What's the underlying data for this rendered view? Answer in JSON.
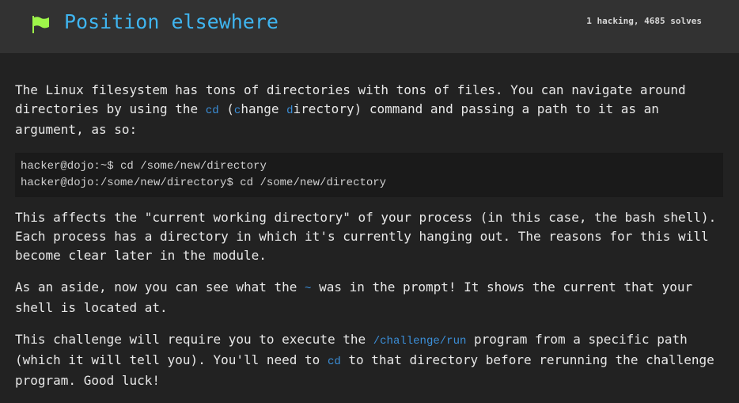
{
  "header": {
    "title": "Position elsewhere",
    "stats": "1 hacking, 4685 solves",
    "icon": "flag-icon",
    "colors": {
      "flag": "#9ef54a",
      "title": "#3fb5f0"
    }
  },
  "p1": {
    "a": "The Linux filesystem has tons of directories with tons of files. You can navigate around directories by using the ",
    "code": "cd",
    "b": " (",
    "c1": "c",
    "c": "hange ",
    "d1": "d",
    "d": "irectory) command and passing a path to it as an argument, as so:"
  },
  "code_block": [
    "hacker@dojo:~$ cd /some/new/directory",
    "hacker@dojo:/some/new/directory$ cd /some/new/directory"
  ],
  "p2": "This affects the \"current working directory\" of your process (in this case, the bash shell). Each process has a directory in which it's currently hanging out. The reasons for this will become clear later in the module.",
  "p3": {
    "a": "As an aside, now you can see what the ",
    "code": "~",
    "b": " was in the prompt! It shows the current that your shell is located at."
  },
  "p4": {
    "a": "This challenge will require you to execute the ",
    "code": "/challenge/run",
    "b": " program from a specific path (which it will tell you). You'll need to ",
    "code2": "cd",
    "c": " to that directory before rerunning the challenge program. Good luck!"
  }
}
